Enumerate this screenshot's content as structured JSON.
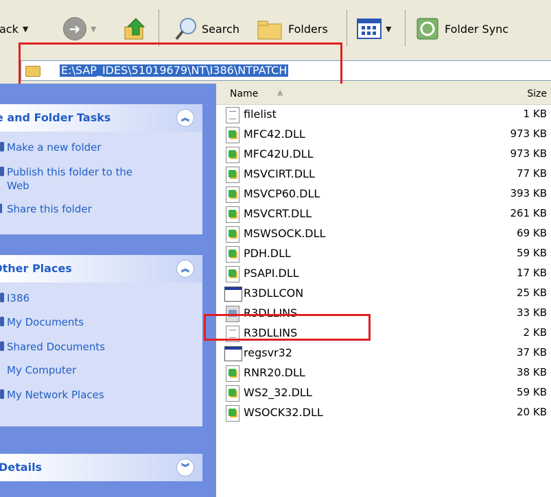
{
  "toolbar": {
    "back_label": "Back",
    "search_label": "Search",
    "folders_label": "Folders",
    "folder_sync_label": "Folder Sync"
  },
  "address": {
    "path": "E:\\SAP_IDES\\51019679\\NT\\I386\\NTPATCH"
  },
  "tasks": {
    "folder_tasks_header": "File and Folder Tasks",
    "items": [
      "Make a new folder",
      "Publish this folder to the Web",
      "Share this folder"
    ],
    "other_places_header": "Other Places",
    "other_places": [
      "I386",
      "My Documents",
      "Shared Documents",
      "My Computer",
      "My Network Places"
    ],
    "details_header": "Details"
  },
  "list": {
    "col_name": "Name",
    "col_size": "Size",
    "rows": [
      {
        "name": "filelist",
        "size": "1 KB",
        "icon": "text-file-icon"
      },
      {
        "name": "MFC42.DLL",
        "size": "973 KB",
        "icon": "dll-file-icon"
      },
      {
        "name": "MFC42U.DLL",
        "size": "973 KB",
        "icon": "dll-file-icon"
      },
      {
        "name": "MSVCIRT.DLL",
        "size": "77 KB",
        "icon": "dll-file-icon"
      },
      {
        "name": "MSVCP60.DLL",
        "size": "393 KB",
        "icon": "dll-file-icon"
      },
      {
        "name": "MSVCRT.DLL",
        "size": "261 KB",
        "icon": "dll-file-icon"
      },
      {
        "name": "MSWSOCK.DLL",
        "size": "69 KB",
        "icon": "dll-file-icon"
      },
      {
        "name": "PDH.DLL",
        "size": "59 KB",
        "icon": "dll-file-icon"
      },
      {
        "name": "PSAPI.DLL",
        "size": "17 KB",
        "icon": "dll-file-icon"
      },
      {
        "name": "R3DLLCON",
        "size": "25 KB",
        "icon": "application-icon"
      },
      {
        "name": "R3DLLINS",
        "size": "33 KB",
        "icon": "installer-icon"
      },
      {
        "name": "R3DLLINS",
        "size": "2 KB",
        "icon": "text-file-icon"
      },
      {
        "name": "regsvr32",
        "size": "37 KB",
        "icon": "application-icon"
      },
      {
        "name": "RNR20.DLL",
        "size": "38 KB",
        "icon": "dll-file-icon"
      },
      {
        "name": "WS2_32.DLL",
        "size": "59 KB",
        "icon": "dll-file-icon"
      },
      {
        "name": "WSOCK32.DLL",
        "size": "20 KB",
        "icon": "dll-file-icon"
      }
    ]
  }
}
